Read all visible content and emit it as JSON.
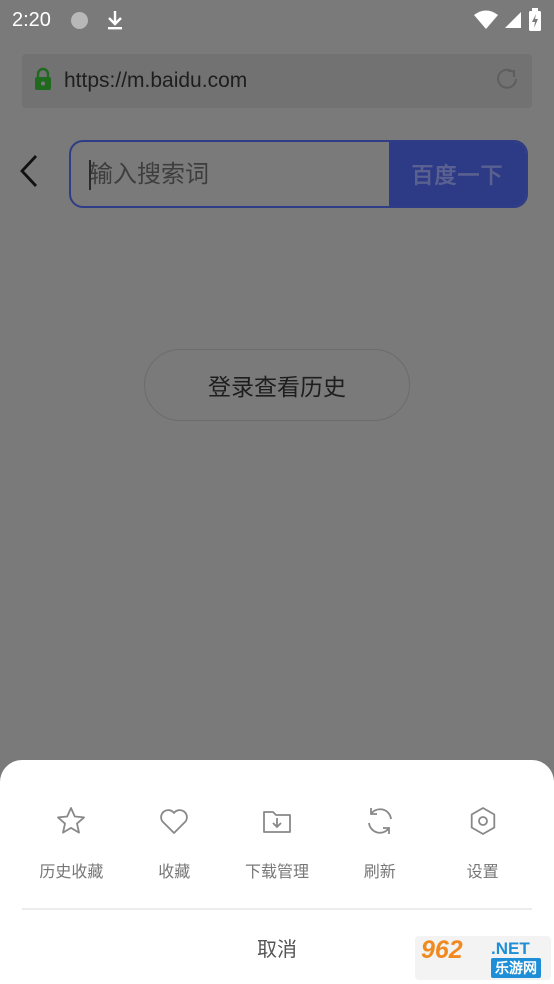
{
  "status_bar": {
    "time": "2:20",
    "icons": [
      "notification-dot-icon",
      "download-icon",
      "wifi-icon",
      "signal-icon",
      "battery-charging-icon"
    ]
  },
  "url_bar": {
    "url": "https://m.baidu.com",
    "lock_icon": "lock-icon",
    "reload_icon": "reload-icon"
  },
  "search": {
    "placeholder": "输入搜索词",
    "button_label": "百度一下",
    "accent_color": "#2d3a86"
  },
  "history_button": {
    "label": "登录查看历史"
  },
  "bottom_sheet": {
    "items": [
      {
        "label": "历史收藏",
        "icon": "star-icon"
      },
      {
        "label": "收藏",
        "icon": "heart-icon"
      },
      {
        "label": "下载管理",
        "icon": "download-folder-icon"
      },
      {
        "label": "刷新",
        "icon": "refresh-icon"
      },
      {
        "label": "设置",
        "icon": "settings-icon"
      }
    ],
    "cancel_label": "取消"
  },
  "watermark": {
    "logo": "962",
    "net": ".NET",
    "sub": "乐游网"
  }
}
